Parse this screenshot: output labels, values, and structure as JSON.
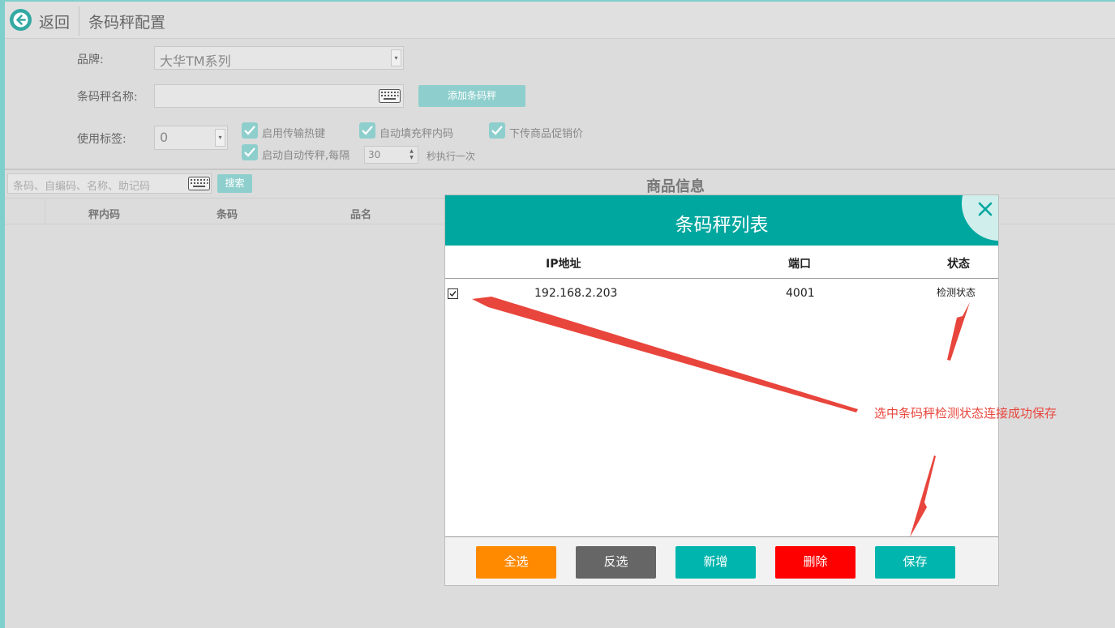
{
  "header": {
    "back_label": "返回",
    "title": "条码秤配置"
  },
  "form": {
    "brand_label": "品牌:",
    "brand_value": "大华TM系列",
    "scale_name_label": "条码秤名称:",
    "scale_name_value": "",
    "add_button": "添加条码秤",
    "label_label": "使用标签:",
    "label_value": "0",
    "checkboxes": [
      {
        "label": "启用传输热键",
        "checked": true
      },
      {
        "label": "自动填充秤内码",
        "checked": true
      },
      {
        "label": "下传商品促销价",
        "checked": true
      },
      {
        "label": "启动自动传秤,每隔",
        "checked": true
      }
    ],
    "interval_value": "30",
    "interval_suffix": "秒执行一次"
  },
  "search": {
    "placeholder": "条码、自编码、名称、助记码",
    "button": "搜索"
  },
  "product_section": {
    "title": "商品信息",
    "columns": [
      "秤内码",
      "条码",
      "品名"
    ]
  },
  "modal": {
    "title": "条码秤列表",
    "columns": [
      "IP地址",
      "端口",
      "状态"
    ],
    "rows": [
      {
        "checked": true,
        "ip": "192.168.2.203",
        "port": "4001",
        "status": "检测状态"
      }
    ],
    "buttons": {
      "select_all": "全选",
      "invert": "反选",
      "add": "新增",
      "delete": "删除",
      "save": "保存"
    },
    "button_colors": {
      "select_all": "#ff8a00",
      "invert": "#666666",
      "add": "#00b5ad",
      "delete": "#ff0000",
      "save": "#00b5ad"
    }
  },
  "annotation": {
    "text": "选中条码秤检测状态连接成功保存",
    "color": "#e8453c"
  }
}
